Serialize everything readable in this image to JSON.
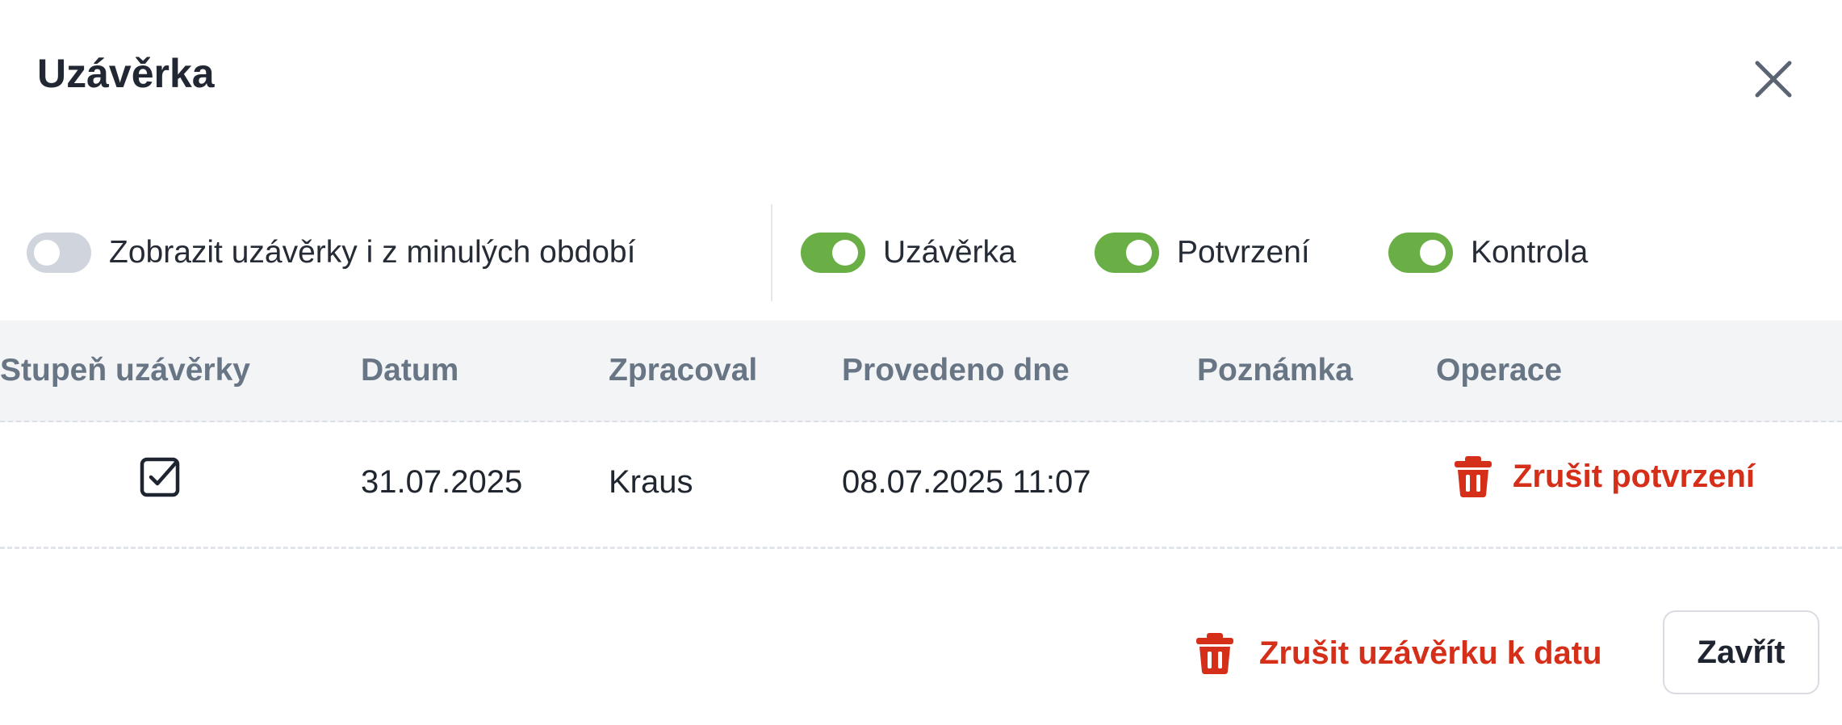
{
  "dialog": {
    "title": "Uzávěrka"
  },
  "filters": {
    "past_periods": {
      "label": "Zobrazit uzávěrky i z minulých období",
      "checked": false
    },
    "closing": {
      "label": "Uzávěrka",
      "checked": true
    },
    "confirmation": {
      "label": "Potvrzení",
      "checked": true
    },
    "control": {
      "label": "Kontrola",
      "checked": true
    }
  },
  "table": {
    "columns": [
      "Stupeň uzávěrky",
      "Datum",
      "Zpracoval",
      "Provedeno dne",
      "Poznámka",
      "Operace"
    ],
    "rows": [
      {
        "level_icon": "checkbox-checked-icon",
        "date": "31.07.2025",
        "processed_by": "Kraus",
        "performed_on": "08.07.2025 11:07",
        "note": "",
        "operation": {
          "icon": "trash-icon",
          "label": "Zrušit potvrzení"
        }
      }
    ]
  },
  "footer": {
    "cancel_closing": {
      "icon": "trash-icon",
      "label": "Zrušit uzávěrku k datu"
    },
    "close_label": "Zavřít"
  },
  "colors": {
    "accent_green": "#6aaf45",
    "danger_red": "#d52f1a",
    "header_bg": "#f3f4f6"
  }
}
